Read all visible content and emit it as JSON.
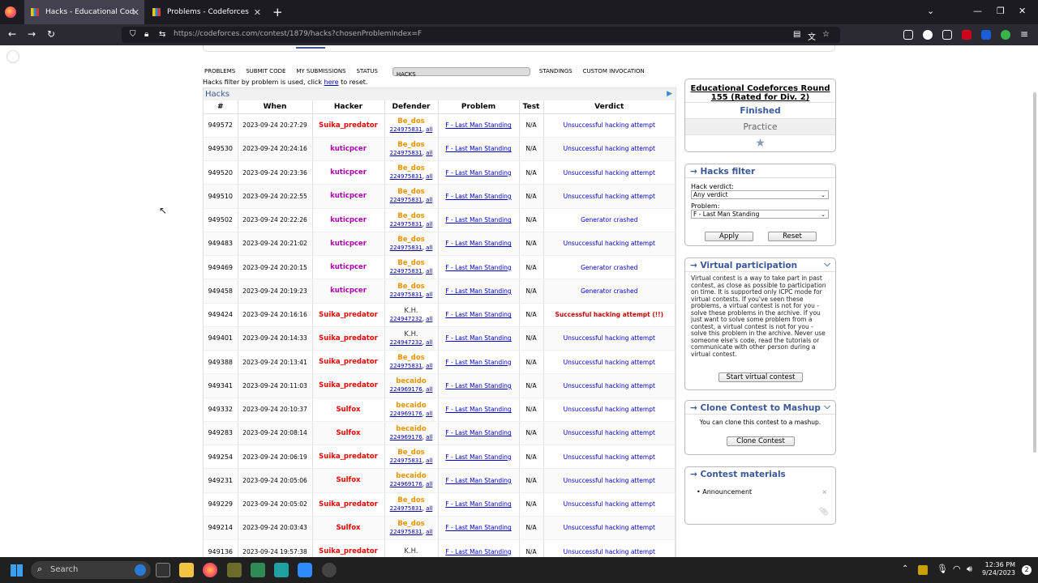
{
  "browser": {
    "tabs": [
      {
        "label": "Hacks - Educational Codeforce",
        "active": true
      },
      {
        "label": "Problems - Codeforces",
        "active": false
      }
    ],
    "url": "https://codeforces.com/contest/1879/hacks?chosenProblemIndex=F"
  },
  "menu": [
    "Problems",
    "Submit Code",
    "My Submissions",
    "Status",
    "Hacks",
    "Standings",
    "Custom Invocation"
  ],
  "menu_selected": "Hacks",
  "filter_note": {
    "prefix": "Hacks filter by problem is used, click ",
    "link": "here",
    "suffix": " to reset."
  },
  "hacks": {
    "title": "Hacks",
    "columns": [
      "#",
      "When",
      "Hacker",
      "Defender",
      "Problem",
      "Test",
      "Verdict"
    ],
    "rows": [
      {
        "id": "949572",
        "when": "2023-09-24 20:27:29",
        "hacker": "Suika_predator",
        "hcolor": "red",
        "def": "Be_dos",
        "dcolor": "orange",
        "sub": "224975831",
        "prob": "F - Last Man Standing",
        "test": "N/A",
        "verdict": "Unsuccessful hacking attempt",
        "vtype": "ok"
      },
      {
        "id": "949530",
        "when": "2023-09-24 20:24:16",
        "hacker": "kuticpcer",
        "hcolor": "purple",
        "def": "Be_dos",
        "dcolor": "orange",
        "sub": "224975831",
        "prob": "F - Last Man Standing",
        "test": "N/A",
        "verdict": "Unsuccessful hacking attempt",
        "vtype": "ok"
      },
      {
        "id": "949520",
        "when": "2023-09-24 20:23:36",
        "hacker": "kuticpcer",
        "hcolor": "purple",
        "def": "Be_dos",
        "dcolor": "orange",
        "sub": "224975831",
        "prob": "F - Last Man Standing",
        "test": "N/A",
        "verdict": "Unsuccessful hacking attempt",
        "vtype": "ok"
      },
      {
        "id": "949510",
        "when": "2023-09-24 20:22:55",
        "hacker": "kuticpcer",
        "hcolor": "purple",
        "def": "Be_dos",
        "dcolor": "orange",
        "sub": "224975831",
        "prob": "F - Last Man Standing",
        "test": "N/A",
        "verdict": "Unsuccessful hacking attempt",
        "vtype": "ok"
      },
      {
        "id": "949502",
        "when": "2023-09-24 20:22:26",
        "hacker": "kuticpcer",
        "hcolor": "purple",
        "def": "Be_dos",
        "dcolor": "orange",
        "sub": "224975831",
        "prob": "F - Last Man Standing",
        "test": "N/A",
        "verdict": "Generator crashed",
        "vtype": "fail"
      },
      {
        "id": "949483",
        "when": "2023-09-24 20:21:02",
        "hacker": "kuticpcer",
        "hcolor": "purple",
        "def": "Be_dos",
        "dcolor": "orange",
        "sub": "224975831",
        "prob": "F - Last Man Standing",
        "test": "N/A",
        "verdict": "Unsuccessful hacking attempt",
        "vtype": "ok"
      },
      {
        "id": "949469",
        "when": "2023-09-24 20:20:15",
        "hacker": "kuticpcer",
        "hcolor": "purple",
        "def": "Be_dos",
        "dcolor": "orange",
        "sub": "224975831",
        "prob": "F - Last Man Standing",
        "test": "N/A",
        "verdict": "Generator crashed",
        "vtype": "fail"
      },
      {
        "id": "949458",
        "when": "2023-09-24 20:19:23",
        "hacker": "kuticpcer",
        "hcolor": "purple",
        "def": "Be_dos",
        "dcolor": "orange",
        "sub": "224975831",
        "prob": "F - Last Man Standing",
        "test": "N/A",
        "verdict": "Generator crashed",
        "vtype": "fail"
      },
      {
        "id": "949424",
        "when": "2023-09-24 20:16:16",
        "hacker": "Suika_predator",
        "hcolor": "red",
        "def": "K.H.",
        "dcolor": "black",
        "sub": "224947232",
        "prob": "F - Last Man Standing",
        "test": "N/A",
        "verdict": "Successful hacking attempt (!!)",
        "vtype": "succ"
      },
      {
        "id": "949401",
        "when": "2023-09-24 20:14:33",
        "hacker": "Suika_predator",
        "hcolor": "red",
        "def": "K.H.",
        "dcolor": "black",
        "sub": "224947232",
        "prob": "F - Last Man Standing",
        "test": "N/A",
        "verdict": "Unsuccessful hacking attempt",
        "vtype": "ok"
      },
      {
        "id": "949388",
        "when": "2023-09-24 20:13:41",
        "hacker": "Suika_predator",
        "hcolor": "red",
        "def": "Be_dos",
        "dcolor": "orange",
        "sub": "224975831",
        "prob": "F - Last Man Standing",
        "test": "N/A",
        "verdict": "Unsuccessful hacking attempt",
        "vtype": "ok"
      },
      {
        "id": "949341",
        "when": "2023-09-24 20:11:03",
        "hacker": "Suika_predator",
        "hcolor": "red",
        "def": "becaido",
        "dcolor": "orange",
        "sub": "224969176",
        "prob": "F - Last Man Standing",
        "test": "N/A",
        "verdict": "Unsuccessful hacking attempt",
        "vtype": "ok"
      },
      {
        "id": "949332",
        "when": "2023-09-24 20:10:37",
        "hacker": "Sulfox",
        "hcolor": "red",
        "def": "becaido",
        "dcolor": "orange",
        "sub": "224969176",
        "prob": "F - Last Man Standing",
        "test": "N/A",
        "verdict": "Unsuccessful hacking attempt",
        "vtype": "ok"
      },
      {
        "id": "949283",
        "when": "2023-09-24 20:08:14",
        "hacker": "Sulfox",
        "hcolor": "red",
        "def": "becaido",
        "dcolor": "orange",
        "sub": "224969176",
        "prob": "F - Last Man Standing",
        "test": "N/A",
        "verdict": "Unsuccessful hacking attempt",
        "vtype": "ok"
      },
      {
        "id": "949254",
        "when": "2023-09-24 20:06:19",
        "hacker": "Suika_predator",
        "hcolor": "red",
        "def": "Be_dos",
        "dcolor": "orange",
        "sub": "224975831",
        "prob": "F - Last Man Standing",
        "test": "N/A",
        "verdict": "Unsuccessful hacking attempt",
        "vtype": "ok"
      },
      {
        "id": "949231",
        "when": "2023-09-24 20:05:06",
        "hacker": "Sulfox",
        "hcolor": "red",
        "def": "becaido",
        "dcolor": "orange",
        "sub": "224969176",
        "prob": "F - Last Man Standing",
        "test": "N/A",
        "verdict": "Unsuccessful hacking attempt",
        "vtype": "ok"
      },
      {
        "id": "949229",
        "when": "2023-09-24 20:05:02",
        "hacker": "Suika_predator",
        "hcolor": "red",
        "def": "Be_dos",
        "dcolor": "orange",
        "sub": "224975831",
        "prob": "F - Last Man Standing",
        "test": "N/A",
        "verdict": "Unsuccessful hacking attempt",
        "vtype": "ok"
      },
      {
        "id": "949214",
        "when": "2023-09-24 20:03:43",
        "hacker": "Sulfox",
        "hcolor": "red",
        "def": "Be_dos",
        "dcolor": "orange",
        "sub": "224975831",
        "prob": "F - Last Man Standing",
        "test": "N/A",
        "verdict": "Unsuccessful hacking attempt",
        "vtype": "ok"
      },
      {
        "id": "949136",
        "when": "2023-09-24 19:57:38",
        "hacker": "Suika_predator",
        "hcolor": "red",
        "def": "K.H.",
        "dcolor": "black",
        "sub": "",
        "prob": "F - Last Man Standing",
        "test": "N/A",
        "verdict": "Unsuccessful hacking attempt",
        "vtype": "ok"
      }
    ],
    "all_label": "all"
  },
  "contest": {
    "name": "Educational Codeforces Round 155 (Rated for Div. 2)",
    "status": "Finished",
    "mode": "Practice",
    "star_icon": "star-icon"
  },
  "hacks_filter": {
    "title": "Hacks filter",
    "verdict_label": "Hack verdict:",
    "verdict_value": "Any verdict",
    "problem_label": "Problem:",
    "problem_value": "F - Last Man Standing",
    "apply": "Apply",
    "reset": "Reset"
  },
  "virtual": {
    "title": "Virtual participation",
    "text": "Virtual contest is a way to take part in past contest, as close as possible to participation on time. It is supported only ICPC mode for virtual contests. If you've seen these problems, a virtual contest is not for you - solve these problems in the archive. If you just want to solve some problem from a contest, a virtual contest is not for you - solve this problem in the archive. Never use someone else's code, read the tutorials or communicate with other person during a virtual contest.",
    "button": "Start virtual contest"
  },
  "clone": {
    "title": "Clone Contest to Mashup",
    "text": "You can clone this contest to a mashup.",
    "button": "Clone Contest"
  },
  "materials": {
    "title": "Contest materials",
    "items": [
      "Announcement"
    ]
  },
  "taskbar": {
    "search": "Search",
    "time": "12:36 PM",
    "date": "9/24/2023",
    "notif": "2"
  }
}
